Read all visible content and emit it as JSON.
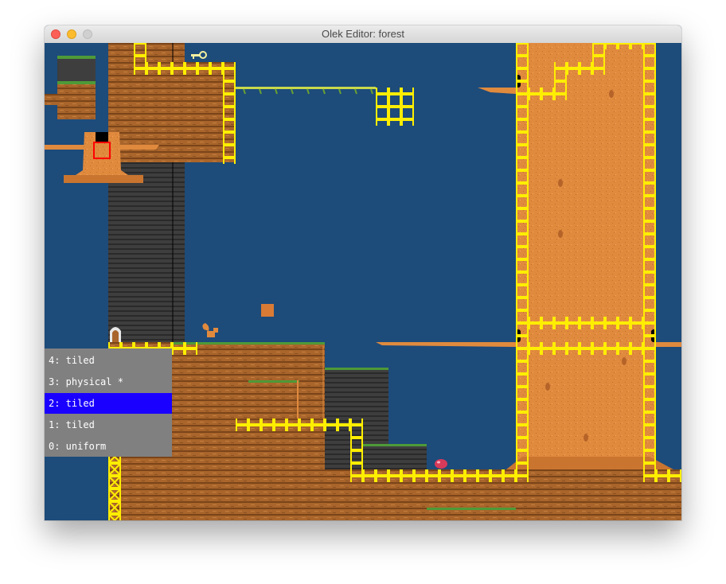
{
  "window": {
    "title": "Olek Editor: forest"
  },
  "layers": [
    {
      "label": "4: tiled",
      "selected": false
    },
    {
      "label": "3: physical *",
      "selected": false
    },
    {
      "label": "2: tiled",
      "selected": true
    },
    {
      "label": "1: tiled",
      "selected": false
    },
    {
      "label": "0: uniform",
      "selected": false
    }
  ],
  "colors": {
    "sky": "#1d4b7a",
    "ground": "#a9652b",
    "dark_ground": "#3a3a3a",
    "tree_trunk": "#e48a3c",
    "grass": "#4e9a38",
    "outline": "#ffee00",
    "selection": "#ff0000",
    "selected_layer": "#1a00ff",
    "layer_panel": "#808080"
  },
  "icons": [
    "key-icon",
    "squirrel-sprite",
    "arch-door-icon",
    "berry-sprite"
  ]
}
